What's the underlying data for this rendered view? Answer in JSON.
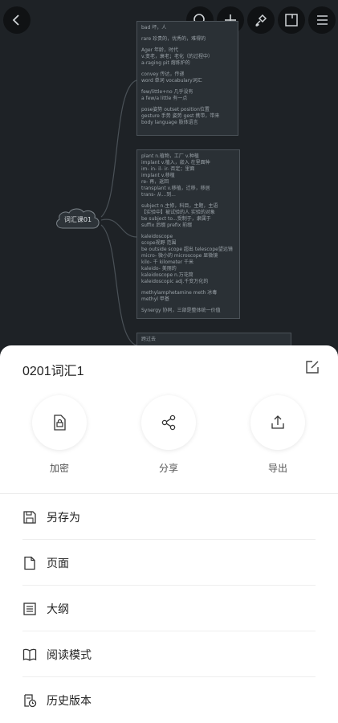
{
  "canvas": {
    "center_node_label": "词汇课01",
    "box1": [
      "bad 坏，人",
      "",
      "rare 珍贵的，优秀的，难得的",
      "",
      "Ager 年龄，时代",
      "v.变老，衰老；老化（的过程中）",
      "a-raging pit 熔炼炉的",
      "",
      "convey 传达，传递",
      "word 单词 vocabulary词汇",
      "",
      "few/little+no 几乎没有",
      "a few/a little 有一点",
      "",
      "pose姿势 outset position位置",
      "gesture 手势 姿势 gest 携带，带来",
      "body language 肢体语言"
    ],
    "box2": [
      "plant n.植物，工厂 v.种植",
      "implant v.植入，嵌入 在里面种",
      "im- in- il- ir- 否定；里面",
      "implant v.移植",
      "re- 再，返回",
      "transplant v.移植，迁移，移居",
      "trans- 从...到...",
      "",
      "subject n.主修，科目，主题，主语",
      "【实验中】被试验的人 实验的对象",
      "be subject to...受制于，隶属于",
      "suffix 后缀 prefix 前缀",
      "",
      "kaleidoscope",
      "scope视野 范围",
      "be outside scope 超出 telescope望远镜",
      "micro- 微小的 microscope 显微镜",
      "kilo- 千 kilometer 千米",
      "kaleido- 美丽的",
      "kaleidoscope n.万花筒",
      "kaleidoscopic adj.千变万化的",
      "",
      "methylamphetamine meth 冰毒",
      "methyl 甲基",
      "",
      "Synergy 协同，三部是整体统一价值"
    ],
    "box3": [
      "跨过去"
    ]
  },
  "sheet": {
    "title": "0201词汇1",
    "actions": [
      {
        "label": "加密",
        "icon": "lock-doc-icon"
      },
      {
        "label": "分享",
        "icon": "share-icon"
      },
      {
        "label": "导出",
        "icon": "export-icon"
      }
    ],
    "menu": [
      {
        "label": "另存为",
        "icon": "save-as-icon"
      },
      {
        "label": "页面",
        "icon": "page-icon"
      },
      {
        "label": "大纲",
        "icon": "outline-icon"
      },
      {
        "label": "阅读模式",
        "icon": "book-icon"
      },
      {
        "label": "历史版本",
        "icon": "history-icon"
      }
    ]
  }
}
